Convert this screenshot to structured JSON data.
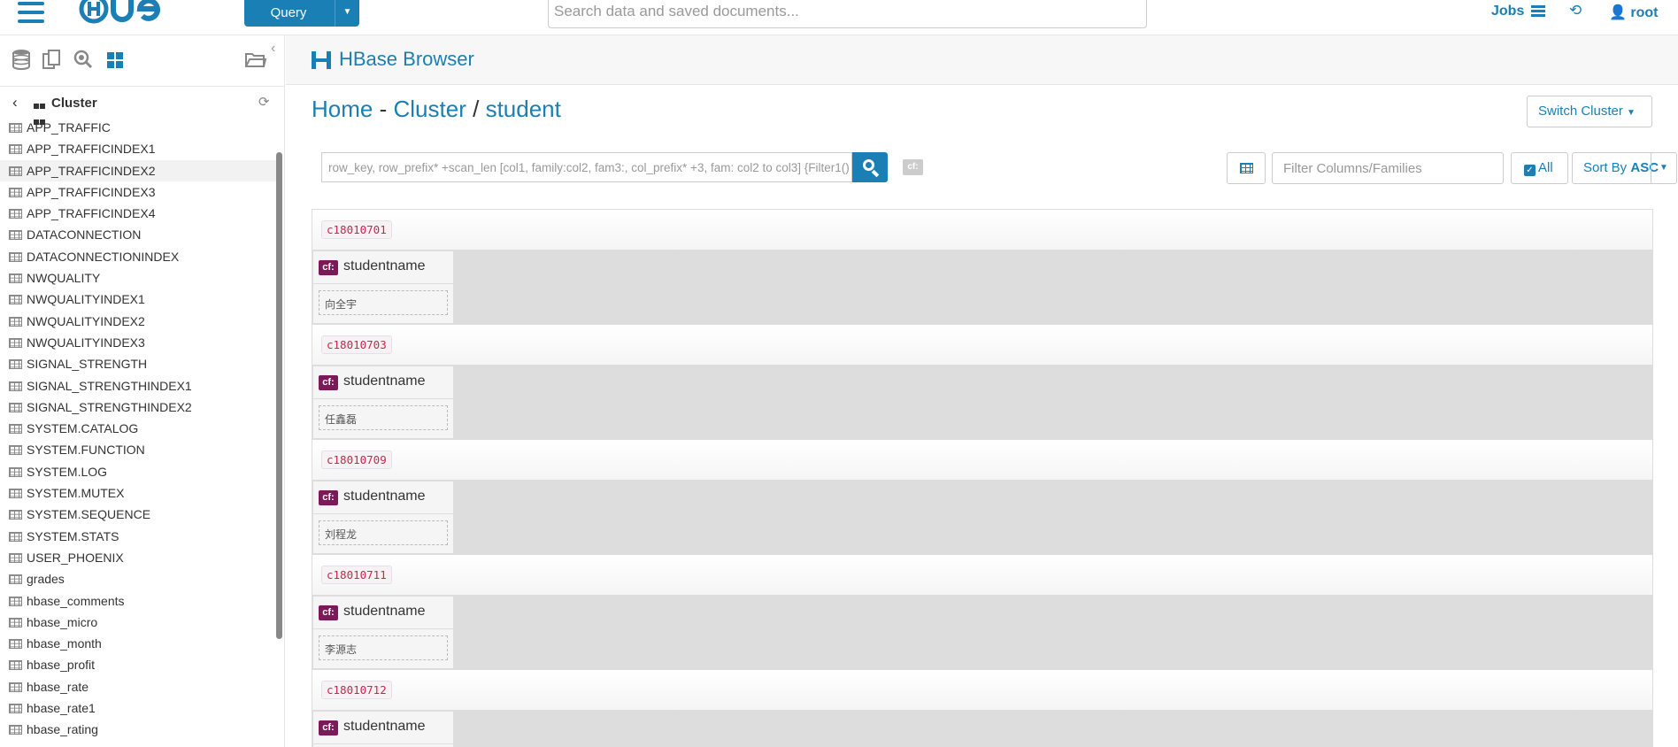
{
  "topbar": {
    "logo": "HUE",
    "query_label": "Query",
    "search_placeholder": "Search data and saved documents...",
    "jobs_label": "Jobs",
    "user_label": "root"
  },
  "sidebar": {
    "title": "Cluster",
    "tables": [
      "APP_TRAFFIC",
      "APP_TRAFFICINDEX1",
      "APP_TRAFFICINDEX2",
      "APP_TRAFFICINDEX3",
      "APP_TRAFFICINDEX4",
      "DATACONNECTION",
      "DATACONNECTIONINDEX",
      "NWQUALITY",
      "NWQUALITYINDEX1",
      "NWQUALITYINDEX2",
      "NWQUALITYINDEX3",
      "SIGNAL_STRENGTH",
      "SIGNAL_STRENGTHINDEX1",
      "SIGNAL_STRENGTHINDEX2",
      "SYSTEM.CATALOG",
      "SYSTEM.FUNCTION",
      "SYSTEM.LOG",
      "SYSTEM.MUTEX",
      "SYSTEM.SEQUENCE",
      "SYSTEM.STATS",
      "USER_PHOENIX",
      "grades",
      "hbase_comments",
      "hbase_micro",
      "hbase_month",
      "hbase_profit",
      "hbase_rate",
      "hbase_rate1",
      "hbase_rating"
    ],
    "highlighted_index": 2
  },
  "app": {
    "title": "HBase Browser"
  },
  "breadcrumb": {
    "home": "Home",
    "sep1": "-",
    "cluster": "Cluster",
    "sep2": "/",
    "table": "student"
  },
  "toolbar": {
    "switch_cluster": "Switch Cluster",
    "query_placeholder": "row_key, row_prefix* +scan_len [col1, family:col2, fam3:, col_prefix* +3, fam: col2 to col3] {Filter1()",
    "cf_chip": "cf:",
    "filter_placeholder": "Filter Columns/Families",
    "all_label": "All",
    "sort_label": "Sort By",
    "sort_dir": "ASC"
  },
  "rows": [
    {
      "key": "c18010701",
      "family": "cf:",
      "column": "studentname",
      "value": "向全宇"
    },
    {
      "key": "c18010703",
      "family": "cf:",
      "column": "studentname",
      "value": "任鑫磊"
    },
    {
      "key": "c18010709",
      "family": "cf:",
      "column": "studentname",
      "value": "刘程龙"
    },
    {
      "key": "c18010711",
      "family": "cf:",
      "column": "studentname",
      "value": "李源志"
    },
    {
      "key": "c18010712",
      "family": "cf:",
      "column": "studentname",
      "value": ""
    }
  ],
  "colors": {
    "brand": "#1a7fb5",
    "family_badge": "#7b1a58",
    "row_key_text": "#c7254e"
  }
}
